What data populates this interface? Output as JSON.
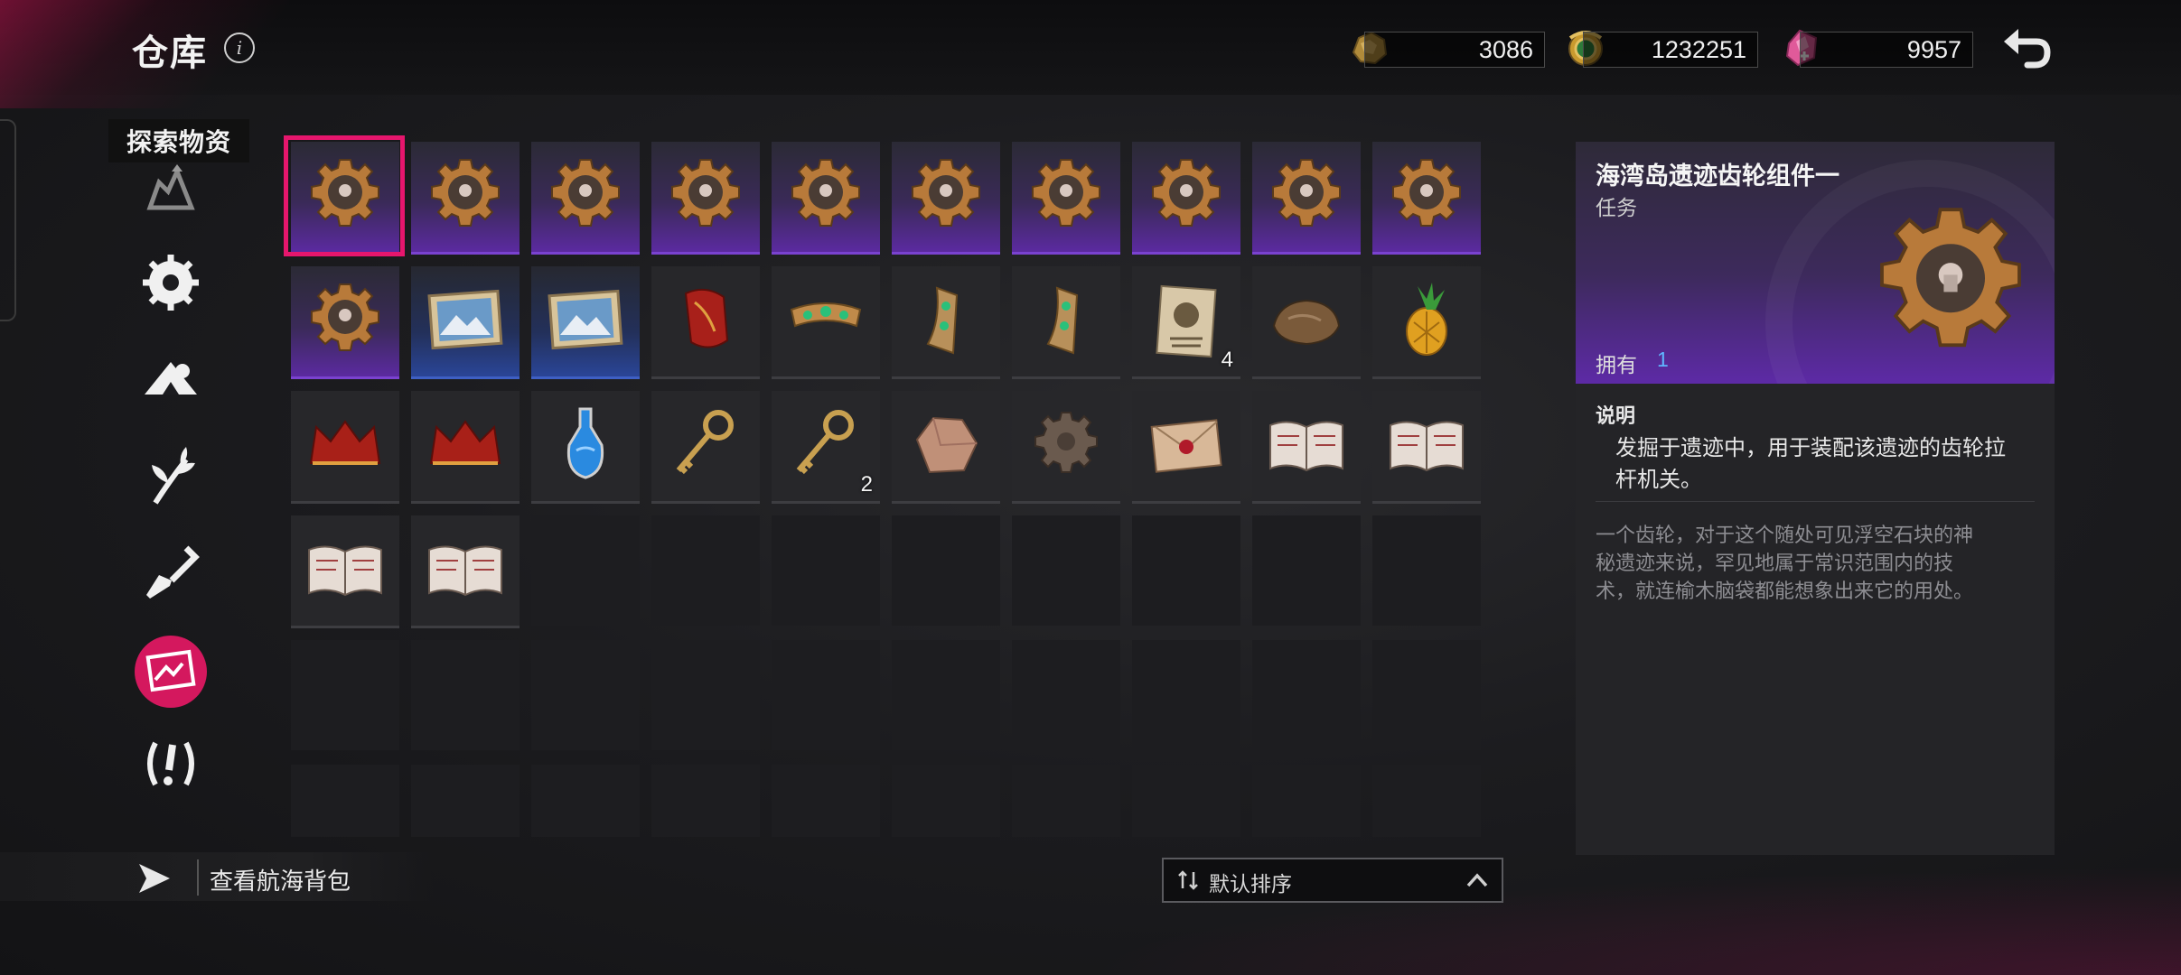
{
  "header": {
    "title": "仓库",
    "info_icon": "info-icon"
  },
  "currencies": [
    {
      "icon": "ore-icon",
      "value": "3086"
    },
    {
      "icon": "gold-coin-icon",
      "value": "1232251"
    },
    {
      "icon": "crystal-icon",
      "value": "9957"
    }
  ],
  "sidebar": {
    "category_label": "探索物资",
    "items": [
      {
        "icon": "mountain-icon"
      },
      {
        "icon": "gear-badge-icon"
      },
      {
        "icon": "camp-icon"
      },
      {
        "icon": "plant-icon"
      },
      {
        "icon": "shovel-icon"
      },
      {
        "icon": "map-icon",
        "active": true
      },
      {
        "icon": "alert-icon"
      }
    ]
  },
  "inventory": {
    "rows": [
      [
        {
          "icon": "gear-icon",
          "rarity": "purple"
        },
        {
          "icon": "gear-icon",
          "rarity": "purple"
        },
        {
          "icon": "gear-icon",
          "rarity": "purple"
        },
        {
          "icon": "gear-icon",
          "rarity": "purple"
        },
        {
          "icon": "gear-icon",
          "rarity": "purple"
        },
        {
          "icon": "gear-icon",
          "rarity": "purple"
        },
        {
          "icon": "gear-icon",
          "rarity": "purple"
        },
        {
          "icon": "gear-icon",
          "rarity": "purple"
        },
        {
          "icon": "gear-icon",
          "rarity": "purple"
        },
        {
          "icon": "gear-icon",
          "rarity": "purple"
        }
      ],
      [
        {
          "icon": "gear-icon",
          "rarity": "purple"
        },
        {
          "icon": "painting-icon",
          "rarity": "blue"
        },
        {
          "icon": "painting-icon",
          "rarity": "blue"
        },
        {
          "icon": "red-cloth-icon",
          "rarity": "normal"
        },
        {
          "icon": "jeweled-band-icon",
          "rarity": "normal"
        },
        {
          "icon": "jeweled-fragment-icon",
          "rarity": "normal"
        },
        {
          "icon": "jeweled-fragment-icon",
          "rarity": "normal"
        },
        {
          "icon": "wanted-poster-icon",
          "rarity": "normal",
          "count": "4"
        },
        {
          "icon": "stone-icon",
          "rarity": "normal"
        },
        {
          "icon": "pineapple-icon",
          "rarity": "normal"
        }
      ],
      [
        {
          "icon": "red-crown-icon",
          "rarity": "normal"
        },
        {
          "icon": "red-crown-icon",
          "rarity": "normal"
        },
        {
          "icon": "potion-icon",
          "rarity": "normal"
        },
        {
          "icon": "key-icon",
          "rarity": "normal"
        },
        {
          "icon": "key-icon",
          "rarity": "normal",
          "count": "2"
        },
        {
          "icon": "rock-icon",
          "rarity": "normal"
        },
        {
          "icon": "stone-gear-icon",
          "rarity": "normal"
        },
        {
          "icon": "sealed-letter-icon",
          "rarity": "normal"
        },
        {
          "icon": "book-icon",
          "rarity": "normal"
        },
        {
          "icon": "book-icon",
          "rarity": "normal"
        }
      ],
      [
        {
          "icon": "book-icon",
          "rarity": "normal"
        },
        {
          "icon": "book-icon",
          "rarity": "normal"
        }
      ]
    ]
  },
  "detail": {
    "name": "海湾岛遗迹齿轮组件一",
    "type": "任务",
    "own_label": "拥有",
    "own_count": "1",
    "desc_title": "说明",
    "desc_line1": "发掘于遗迹中，用于装配该遗迹的齿轮拉",
    "desc_line2": "杆机关。",
    "lore_line1": "一个齿轮，对于这个随处可见浮空石块的神",
    "lore_line2": "秘遗迹来说，罕见地属于常识范围内的技",
    "lore_line3": "术，就连榆木脑袋都能想象出来它的用处。"
  },
  "footer": {
    "bag_label": "查看航海背包",
    "sort_label": "默认排序"
  },
  "colors": {
    "accent": "#e6166d",
    "purple_rarity": "#5b2aa0",
    "blue_rarity": "#2a4597",
    "own_count": "#5fb6ff"
  }
}
